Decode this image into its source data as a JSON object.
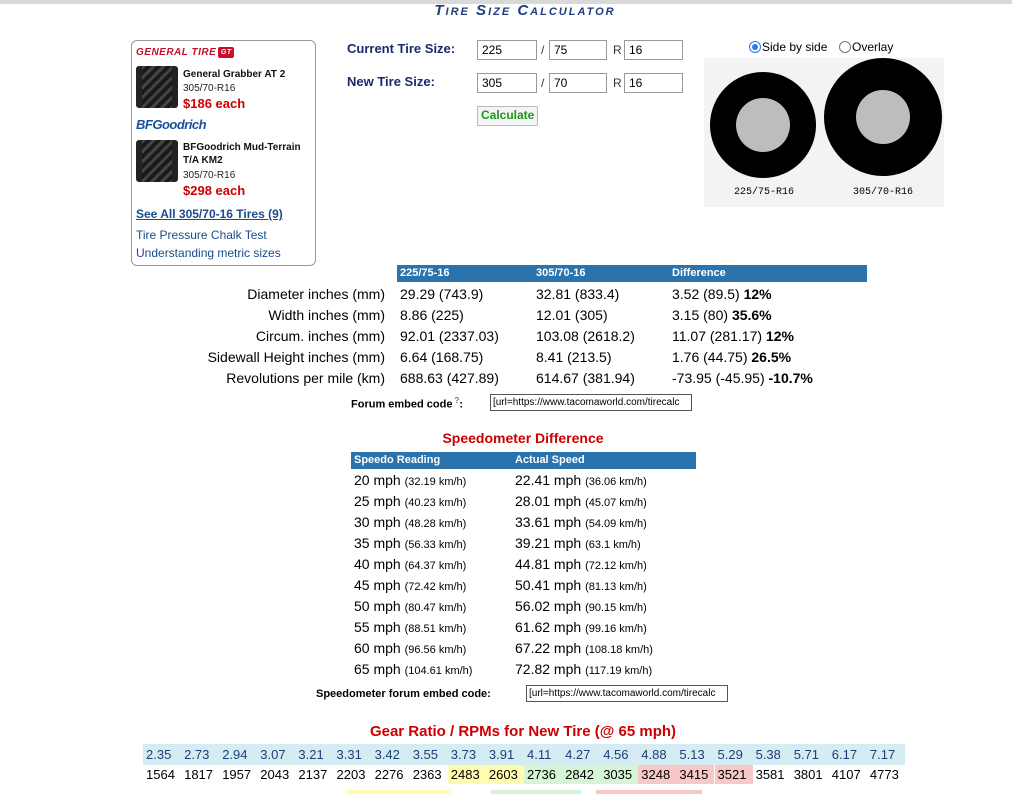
{
  "title": "Tire Size Calculator",
  "ad": {
    "brand1": "GENERAL TIRE",
    "brand1_badge": "GT",
    "product1": {
      "name": "General Grabber AT 2",
      "size": "305/70-R16",
      "price": "$186 each"
    },
    "brand2": "BFGoodrich",
    "product2": {
      "name": "BFGoodrich Mud-Terrain T/A KM2",
      "size": "305/70-R16",
      "price": "$298 each"
    },
    "see_all": "See All 305/70-16 Tires (9)",
    "links": [
      "Tire Pressure Chalk Test",
      "Understanding metric sizes"
    ]
  },
  "form": {
    "current_label": "Current Tire Size:",
    "new_label": "New Tire Size:",
    "current": {
      "width": "225",
      "aspect": "75",
      "rim": "16"
    },
    "new": {
      "width": "305",
      "aspect": "70",
      "rim": "16"
    },
    "slash": "/",
    "r": "R",
    "calculate": "Calculate"
  },
  "view": {
    "side_by_side": "Side by side",
    "overlay": "Overlay",
    "selected": "Side by side",
    "tire1_label": "225/75-R16",
    "tire2_label": "305/70-R16",
    "tire_color": "#000000",
    "wheel_color": "#bdbdbd"
  },
  "comparison": {
    "headers": [
      "225/75-16",
      "305/70-16",
      "Difference"
    ],
    "rows": [
      {
        "label": "Diameter inches (mm)",
        "a": "29.29 (743.9)",
        "b": "32.81 (833.4)",
        "diff": "3.52 (89.5)",
        "pct": "12%"
      },
      {
        "label": "Width inches (mm)",
        "a": "8.86 (225)",
        "b": "12.01 (305)",
        "diff": "3.15 (80)",
        "pct": "35.6%"
      },
      {
        "label": "Circum. inches (mm)",
        "a": "92.01 (2337.03)",
        "b": "103.08 (2618.2)",
        "diff": "11.07 (281.17)",
        "pct": "12%"
      },
      {
        "label": "Sidewall Height inches (mm)",
        "a": "6.64 (168.75)",
        "b": "8.41 (213.5)",
        "diff": "1.76 (44.75)",
        "pct": "26.5%"
      },
      {
        "label": "Revolutions per mile (km)",
        "a": "688.63 (427.89)",
        "b": "614.67 (381.94)",
        "diff": "-73.95 (-45.95)",
        "pct": "-10.7%"
      }
    ],
    "embed_label": "Forum embed code",
    "embed_help": "?",
    "embed_value": "[url=https://www.tacomaworld.com/tirecalc"
  },
  "speedo": {
    "heading": "Speedometer Difference",
    "headers": [
      "Speedo Reading",
      "Actual Speed"
    ],
    "rows": [
      {
        "r": "20 mph",
        "rk": "(32.19 km/h)",
        "a": "22.41 mph",
        "ak": "(36.06 km/h)"
      },
      {
        "r": "25 mph",
        "rk": "(40.23 km/h)",
        "a": "28.01 mph",
        "ak": "(45.07 km/h)"
      },
      {
        "r": "30 mph",
        "rk": "(48.28 km/h)",
        "a": "33.61 mph",
        "ak": "(54.09 km/h)"
      },
      {
        "r": "35 mph",
        "rk": "(56.33 km/h)",
        "a": "39.21 mph",
        "ak": "(63.1 km/h)"
      },
      {
        "r": "40 mph",
        "rk": "(64.37 km/h)",
        "a": "44.81 mph",
        "ak": "(72.12 km/h)"
      },
      {
        "r": "45 mph",
        "rk": "(72.42 km/h)",
        "a": "50.41 mph",
        "ak": "(81.13 km/h)"
      },
      {
        "r": "50 mph",
        "rk": "(80.47 km/h)",
        "a": "56.02 mph",
        "ak": "(90.15 km/h)"
      },
      {
        "r": "55 mph",
        "rk": "(88.51 km/h)",
        "a": "61.62 mph",
        "ak": "(99.16 km/h)"
      },
      {
        "r": "60 mph",
        "rk": "(96.56 km/h)",
        "a": "67.22 mph",
        "ak": "(108.18 km/h)"
      },
      {
        "r": "65 mph",
        "rk": "(104.61 km/h)",
        "a": "72.82 mph",
        "ak": "(117.19 km/h)"
      }
    ],
    "embed_label": "Speedometer forum embed code:",
    "embed_value": "[url=https://www.tacomaworld.com/tirecalc"
  },
  "gear": {
    "heading": "Gear Ratio / RPMs for New Tire (@ 65 mph)",
    "ratios": [
      "2.35",
      "2.73",
      "2.94",
      "3.07",
      "3.21",
      "3.31",
      "3.42",
      "3.55",
      "3.73",
      "3.91",
      "4.11",
      "4.27",
      "4.56",
      "4.88",
      "5.13",
      "5.29",
      "5.38",
      "5.71",
      "6.17",
      "7.17"
    ],
    "rpms": [
      "1564",
      "1817",
      "1957",
      "2043",
      "2137",
      "2203",
      "2276",
      "2363",
      "2483",
      "2603",
      "2736",
      "2842",
      "3035",
      "3248",
      "3415",
      "3521",
      "3581",
      "3801",
      "4107",
      "4773"
    ],
    "rpm_colors": [
      "",
      "",
      "",
      "",
      "",
      "",
      "",
      "",
      "#fffbb0",
      "#fffbb0",
      "#d6f5d6",
      "#d6f5d6",
      "#d6f5d6",
      "#f8c8c8",
      "#f8c8c8",
      "#f8c8c8",
      "",
      "",
      "",
      ""
    ],
    "ratio_bg": "#d6ecf3"
  }
}
